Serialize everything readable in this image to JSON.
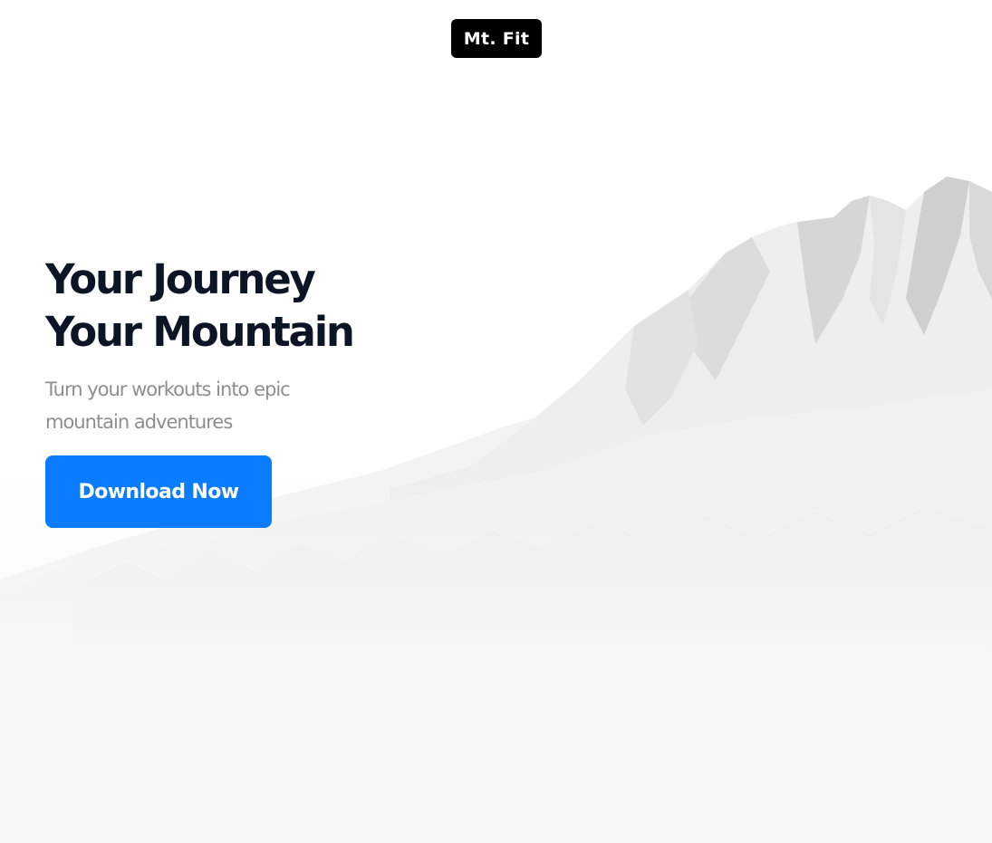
{
  "brand": {
    "logo_text": "Mt. Fit"
  },
  "hero": {
    "headline_line1": "Your Journey",
    "headline_line2": "Your Mountain",
    "subheading": "Turn your workouts into epic mountain adventures",
    "cta_label": "Download Now"
  },
  "colors": {
    "background": "#ffffff",
    "logo_bg": "#000000",
    "headline": "#0b1526",
    "subheading": "#8e8e8e",
    "cta_bg": "#0a7cff",
    "cta_text": "#ffffff"
  }
}
